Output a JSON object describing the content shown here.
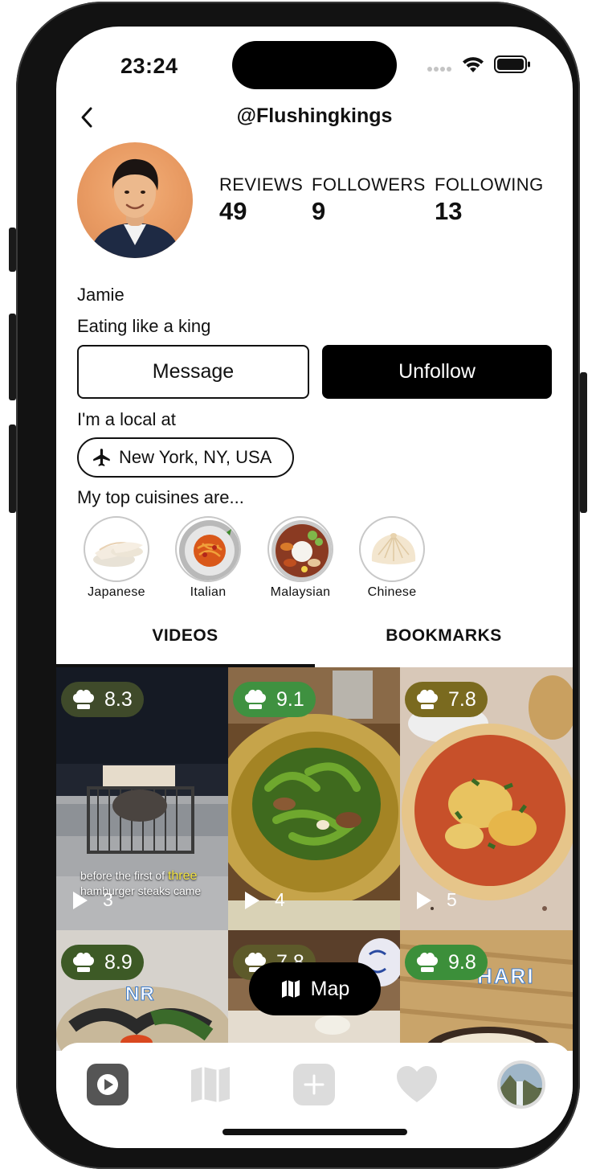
{
  "status_bar": {
    "time": "23:24"
  },
  "header": {
    "handle": "@Flushingkings"
  },
  "profile": {
    "stats": [
      {
        "label": "REVIEWS",
        "value": "49"
      },
      {
        "label": "FOLLOWERS",
        "value": "9"
      },
      {
        "label": "FOLLOWING",
        "value": "13"
      }
    ],
    "name": "Jamie",
    "bio": "Eating like a king",
    "message_label": "Message",
    "unfollow_label": "Unfollow",
    "local_label": "I'm a local at",
    "location": "New York, NY, USA",
    "cuisines_label": "My top cuisines are...",
    "cuisines": [
      "Japanese",
      "Italian",
      "Malaysian",
      "Chinese"
    ]
  },
  "tabs": {
    "videos": "VIDEOS",
    "bookmarks": "BOOKMARKS"
  },
  "grid": [
    {
      "score": "8.3",
      "plays": "3",
      "score_color": "#3f4a2a",
      "caption_prefix": "before the first of ",
      "caption_highlight": "three",
      "caption_line2": "hamburger steaks came",
      "sticker": ""
    },
    {
      "score": "9.1",
      "plays": "4",
      "score_color": "#3f9140",
      "sticker": ""
    },
    {
      "score": "7.8",
      "plays": "5",
      "score_color": "#7a6a1f",
      "sticker": ""
    },
    {
      "score": "8.9",
      "plays": "",
      "score_color": "#3d5a26",
      "sticker": "NR"
    },
    {
      "score": "7.8",
      "plays": "",
      "score_color": "#5d5a2a",
      "sticker": ""
    },
    {
      "score": "9.8",
      "plays": "",
      "score_color": "#3c8f3a",
      "sticker": "HARI"
    }
  ],
  "map_button": {
    "label": "Map"
  },
  "colors": {
    "primary": "#000000",
    "background": "#ffffff",
    "nav_inactive": "#dcdcdc",
    "nav_active": "#555555"
  },
  "icons": {
    "back": "chevron-left-icon",
    "location": "airplane-icon",
    "score": "chef-hat-icon",
    "plays": "play-icon",
    "map": "map-icon",
    "nav": [
      "play-square-icon",
      "map-icon",
      "plus-square-icon",
      "heart-icon",
      "profile-avatar"
    ]
  }
}
